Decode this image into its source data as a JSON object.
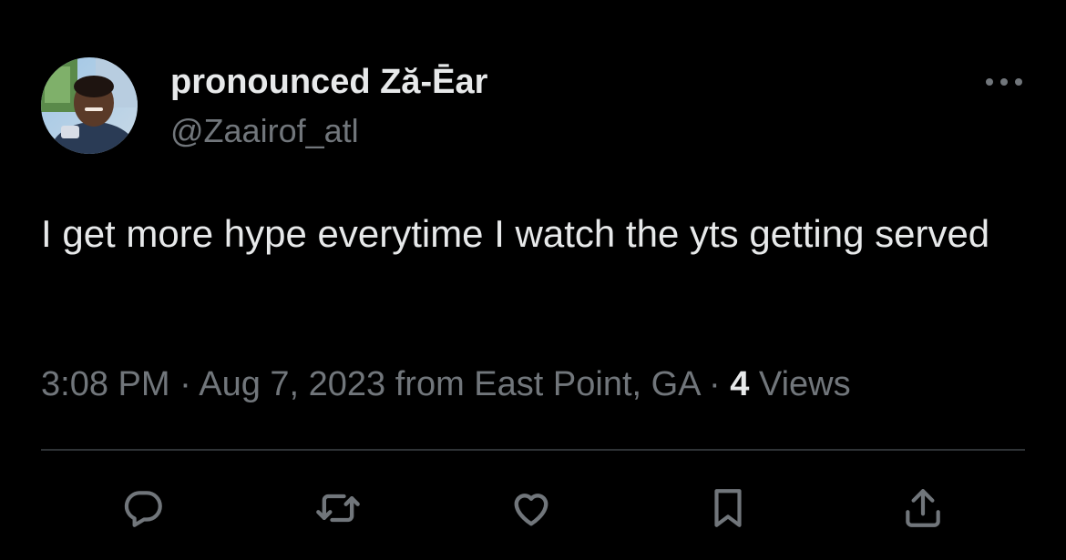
{
  "tweet": {
    "author": {
      "display_name": "pronounced Ză-Ēar",
      "handle": "@Zaairof_atl"
    },
    "text": "I get more hype everytime I watch the yts getting served",
    "meta": {
      "time": "3:08 PM",
      "separator": " · ",
      "date": "Aug 7, 2023",
      "source": " from East Point, GA",
      "views_count": "4",
      "views_label": " Views"
    }
  },
  "actions": {
    "reply_icon": "comment-icon",
    "retweet_icon": "retweet-icon",
    "like_icon": "heart-icon",
    "bookmark_icon": "bookmark-icon",
    "share_icon": "share-icon"
  },
  "colors": {
    "background": "#000000",
    "primary_text": "#e7e9ea",
    "secondary_text": "#71767b",
    "divider": "#2f3336"
  }
}
